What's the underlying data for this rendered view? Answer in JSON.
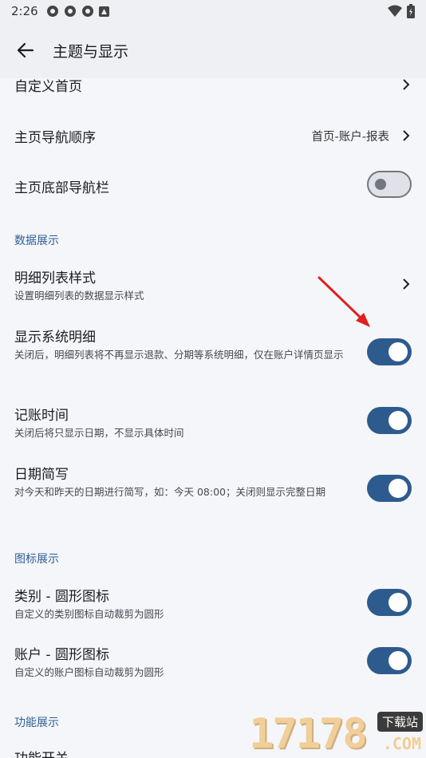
{
  "status_bar": {
    "time": "2:26"
  },
  "app_bar": {
    "title": "主题与显示"
  },
  "rows": {
    "custom_home": {
      "title": "自定义首页"
    },
    "nav_order": {
      "title": "主页导航顺序",
      "value": "首页-账户-报表"
    },
    "bottom_nav": {
      "title": "主页底部导航栏",
      "enabled": false
    },
    "detail_list_style": {
      "title": "明细列表样式",
      "subtitle": "设置明细列表的数据显示样式"
    },
    "show_system_detail": {
      "title": "显示系统明细",
      "subtitle": "关闭后，明细列表将不再显示退款、分期等系统明细，仅在账户详情页显示",
      "enabled": true
    },
    "booking_time": {
      "title": "记账时间",
      "subtitle": "关闭后将只显示日期，不显示具体时间",
      "enabled": true
    },
    "date_short": {
      "title": "日期简写",
      "subtitle": "对今天和昨天的日期进行简写，如：今天 08:00；关闭则显示完整日期",
      "enabled": true
    },
    "category_round": {
      "title": "类别 - 圆形图标",
      "subtitle": "自定义的类别图标自动裁剪为圆形",
      "enabled": true
    },
    "account_round": {
      "title": "账户 - 圆形图标",
      "subtitle": "自定义的账户图标自动裁剪为圆形",
      "enabled": true
    },
    "feature_switch": {
      "title": "功能开关"
    }
  },
  "sections": {
    "data_display": "数据展示",
    "icon_display": "图标展示",
    "feature_display": "功能展示"
  },
  "watermark": {
    "digits": "17178",
    "badge": "下载站",
    "suffix": ".COM"
  },
  "colors": {
    "accent": "#2e5b8e",
    "section": "#2f5f95",
    "annotation_arrow": "#e02020"
  }
}
